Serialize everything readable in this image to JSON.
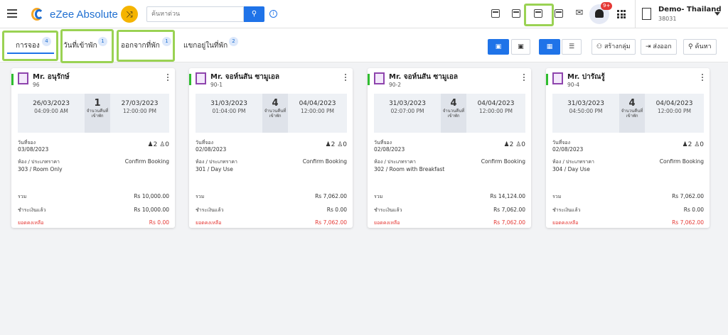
{
  "app": {
    "title": "eZee Absolute",
    "search_placeholder": "ค้นหาด่วน",
    "hotel_name": "Demo- Thailand",
    "hotel_id": "38031",
    "notification_badge": "9+"
  },
  "tabs": [
    {
      "label": "การจอง",
      "count": "4"
    },
    {
      "label": "วันที่เข้าพัก",
      "count": "1"
    },
    {
      "label": "ออกจากที่พัก",
      "count": "1"
    },
    {
      "label": "แขกอยู่ในที่พัก",
      "count": "2"
    }
  ],
  "actions": {
    "group_label": "สร้างกลุ่ม",
    "export_label": "ส่งออก",
    "search_label": "ค้นหา"
  },
  "card_labels": {
    "nights": "จำนวนคืนที่เข้าพัก",
    "booking_date": "วันที่จอง",
    "room_rate": "ห้อง / ประเภทราคา",
    "total": "รวม",
    "paid": "ชำระเงินแล้ว",
    "balance": "ยอดคงเหลือ"
  },
  "bookings": [
    {
      "guest": "Mr. อนุรักษ์",
      "room_no": "96",
      "checkin_date": "26/03/2023",
      "checkin_time": "04:09:00 AM",
      "nights": "1",
      "checkout_date": "27/03/2023",
      "checkout_time": "12:00:00 PM",
      "booking_date": "03/08/2023",
      "adults": "2",
      "children": "0",
      "room_rate": "303 / Room Only",
      "status": "Confirm Booking",
      "total": "Rs 10,000.00",
      "paid": "Rs 10,000.00",
      "balance": "Rs 0.00"
    },
    {
      "guest": "Mr. จอห์นสัน ซามูเอล",
      "room_no": "90-1",
      "checkin_date": "31/03/2023",
      "checkin_time": "01:04:00 PM",
      "nights": "4",
      "checkout_date": "04/04/2023",
      "checkout_time": "12:00:00 PM",
      "booking_date": "02/08/2023",
      "adults": "2",
      "children": "0",
      "room_rate": "301 / Day Use",
      "status": "Confirm Booking",
      "total": "Rs 7,062.00",
      "paid": "Rs 0.00",
      "balance": "Rs 7,062.00"
    },
    {
      "guest": "Mr. จอห์นสัน ซามูเอล",
      "room_no": "90-2",
      "checkin_date": "31/03/2023",
      "checkin_time": "02:07:00 PM",
      "nights": "4",
      "checkout_date": "04/04/2023",
      "checkout_time": "12:00:00 PM",
      "booking_date": "02/08/2023",
      "adults": "2",
      "children": "0",
      "room_rate": "302 / Room with Breakfast",
      "status": "Confirm Booking",
      "total": "Rs 14,124.00",
      "paid": "Rs 7,062.00",
      "balance": "Rs 7,062.00"
    },
    {
      "guest": "Mr. ปารัณรู้",
      "room_no": "90-4",
      "checkin_date": "31/03/2023",
      "checkin_time": "04:50:00 PM",
      "nights": "4",
      "checkout_date": "04/04/2023",
      "checkout_time": "12:00:00 PM",
      "booking_date": "02/08/2023",
      "adults": "2",
      "children": "0",
      "room_rate": "304 / Day Use",
      "status": "Confirm Booking",
      "total": "Rs 7,062.00",
      "paid": "Rs 0.00",
      "balance": "Rs 7,062.00"
    }
  ],
  "colors": {
    "accent": "#1f73e8",
    "highlight": "#9ad253",
    "status_green": "#2fbd2f",
    "balance_red": "#e53935"
  }
}
